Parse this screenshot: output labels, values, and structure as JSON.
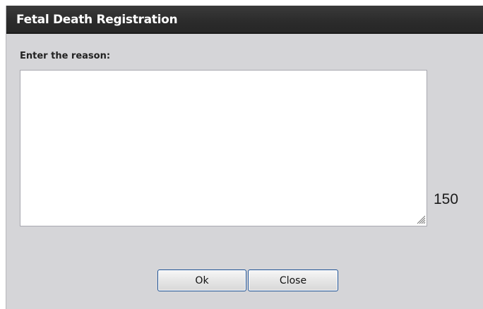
{
  "dialog": {
    "title": "Fetal Death Registration",
    "prompt": "Enter the reason:",
    "reason": {
      "value": "",
      "placeholder": ""
    },
    "char_count": "150",
    "buttons": {
      "ok_label": "Ok",
      "close_label": "Close"
    }
  },
  "colors": {
    "titlebar": "#2c2c2c",
    "dialog_background": "#d5d5d8",
    "button_border": "#1b4f93"
  }
}
